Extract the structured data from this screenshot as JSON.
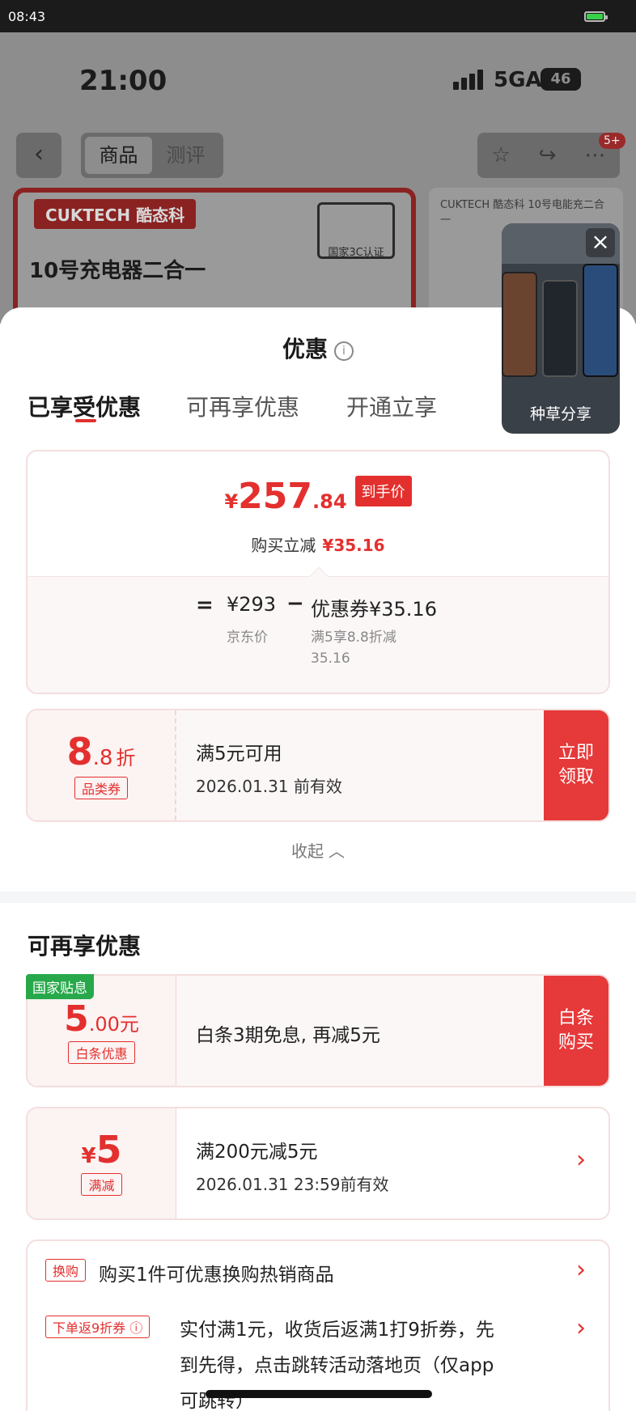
{
  "status_bar": {
    "time": "08:43"
  },
  "background_page": {
    "phone_time": "21:00",
    "network": "5GA",
    "battery": "46",
    "tabs": [
      "商品",
      "测评"
    ],
    "badge": "5+",
    "brand": "CUKTECH 酷态科",
    "cert": "国家3C认证",
    "headline": "10号充电器二合一",
    "side_title": "CUKTECH 酷态科 10号电能充二合一"
  },
  "floating_video": {
    "label": "种草分享"
  },
  "sheet": {
    "title": "优惠",
    "tabs": [
      "已享受优惠",
      "可再享优惠",
      "开通立享"
    ],
    "summary": {
      "price_yen": "¥",
      "price_int": "257",
      "price_dec": ".84",
      "price_tag": "到手价",
      "reduce_label": "购买立减",
      "reduce_value": "¥35.16",
      "eq": "=",
      "base_price": "¥293",
      "minus": "−",
      "coupon_value": "优惠券¥35.16",
      "base_label": "京东价",
      "coupon_desc_1": "满5享8.8折减",
      "coupon_desc_2": "35.16"
    },
    "coupon_discount": {
      "value_big": "8",
      "value_small": ".8",
      "unit": "折",
      "tag": "品类券",
      "condition": "满5元可用",
      "valid": "2026.01.31 前有效",
      "action_1": "立即",
      "action_2": "领取"
    },
    "collapse_label": "收起",
    "more_title": "可再享优惠",
    "baitiao": {
      "badge": "国家贴息",
      "value_big": "5",
      "value_small": ".00元",
      "tag": "白条优惠",
      "desc": "白条3期免息, 再减5元",
      "action_1": "白条",
      "action_2": "购买"
    },
    "manjian": {
      "yen": "¥",
      "value": "5",
      "tag": "满减",
      "condition": "满200元减5元",
      "valid": "2026.01.31 23:59前有效"
    },
    "promos": [
      {
        "tag": "换购",
        "text": "购买1件可优惠换购热销商品"
      },
      {
        "tag": "下单返9折券",
        "text_1": "实付满1元，收货后返满1打9折券，先",
        "text_2": "到先得，点击跳转活动落地页（仅app",
        "text_3": "可跳转）"
      }
    ]
  }
}
